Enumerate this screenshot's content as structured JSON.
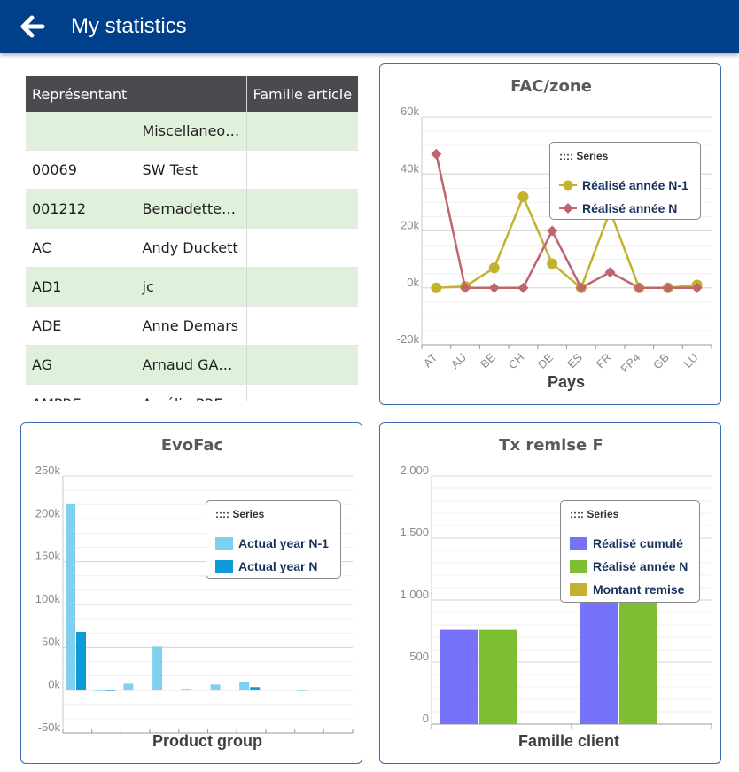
{
  "header": {
    "title": "My statistics",
    "back_icon": "arrow-left-icon"
  },
  "table": {
    "columns": [
      "Représentant",
      "",
      "Famille article"
    ],
    "rows": [
      [
        "",
        "Miscellaneou..",
        ""
      ],
      [
        "00069",
        "SW Test",
        ""
      ],
      [
        "001212",
        "Bernadette H..",
        ""
      ],
      [
        "AC",
        "Andy Duckett",
        ""
      ],
      [
        "AD1",
        "jc",
        ""
      ],
      [
        "ADE",
        "Anne Demars",
        ""
      ],
      [
        "AG",
        "Arnaud GAUT..",
        ""
      ],
      [
        "AMPRE",
        "Amélie PRES..",
        ""
      ]
    ]
  },
  "charts": {
    "fac_zone": {
      "title": "FAC/zone",
      "legend_title": ":::: Series"
    },
    "evofac": {
      "title": "EvoFac",
      "legend_title": ":::: Series"
    },
    "tx_remise": {
      "title": "Tx remise F",
      "legend_title": ":::: Series"
    }
  },
  "chart_data": [
    {
      "type": "line",
      "title": "FAC/zone",
      "xlabel": "Pays",
      "ylabel": "",
      "categories": [
        "AT",
        "AU",
        "BE",
        "CH",
        "DE",
        "ES",
        "FR",
        "FR4",
        "GB",
        "LU"
      ],
      "y_ticks": [
        "60k",
        "40k",
        "20k",
        "0k",
        "-20k"
      ],
      "ylim": [
        -20000,
        60000
      ],
      "series": [
        {
          "name": "Réalisé année N-1",
          "color": "#c2b22e",
          "marker": "circle",
          "values": [
            0,
            500,
            7000,
            32000,
            8500,
            0,
            27000,
            0,
            0,
            1000
          ]
        },
        {
          "name": "Réalisé année N",
          "color": "#c0646e",
          "marker": "diamond",
          "values": [
            47000,
            0,
            0,
            0,
            20000,
            0,
            5500,
            0,
            0,
            0
          ]
        }
      ],
      "grid": true,
      "legend_position": "top-right"
    },
    {
      "type": "bar",
      "title": "EvoFac",
      "xlabel": "Product group",
      "ylabel": "",
      "categories": [
        "",
        "",
        "",
        "",
        "",
        "",
        "",
        "",
        "",
        ""
      ],
      "y_ticks": [
        "250k",
        "200k",
        "150k",
        "100k",
        "50k",
        "0k",
        "-50k"
      ],
      "ylim": [
        -50000,
        250000
      ],
      "series": [
        {
          "name": "Actual year N-1",
          "color": "#7fcfee",
          "values": [
            217000,
            500,
            7500,
            51000,
            1500,
            6500,
            9500,
            0,
            500,
            0
          ]
        },
        {
          "name": "Actual year N",
          "color": "#0d9ad6",
          "values": [
            68000,
            500,
            0,
            0,
            0,
            0,
            3500,
            0,
            0,
            0
          ]
        }
      ],
      "grid": true,
      "legend_position": "top-right"
    },
    {
      "type": "bar",
      "title": "Tx remise F",
      "xlabel": "Famille client",
      "ylabel": "",
      "categories": [
        "",
        ""
      ],
      "y_ticks": [
        "2,000",
        "1,500",
        "1,000",
        "500",
        "0"
      ],
      "ylim": [
        0,
        2000
      ],
      "series": [
        {
          "name": "Réalisé cumulé",
          "color": "#7772fa",
          "values": [
            760,
            1760
          ]
        },
        {
          "name": "Réalisé année N",
          "color": "#7dbe32",
          "values": [
            760,
            1000
          ]
        },
        {
          "name": "Montant remise",
          "color": "#c2b22e",
          "values": [
            0,
            0
          ]
        }
      ],
      "grid": true,
      "legend_position": "top-right"
    }
  ]
}
